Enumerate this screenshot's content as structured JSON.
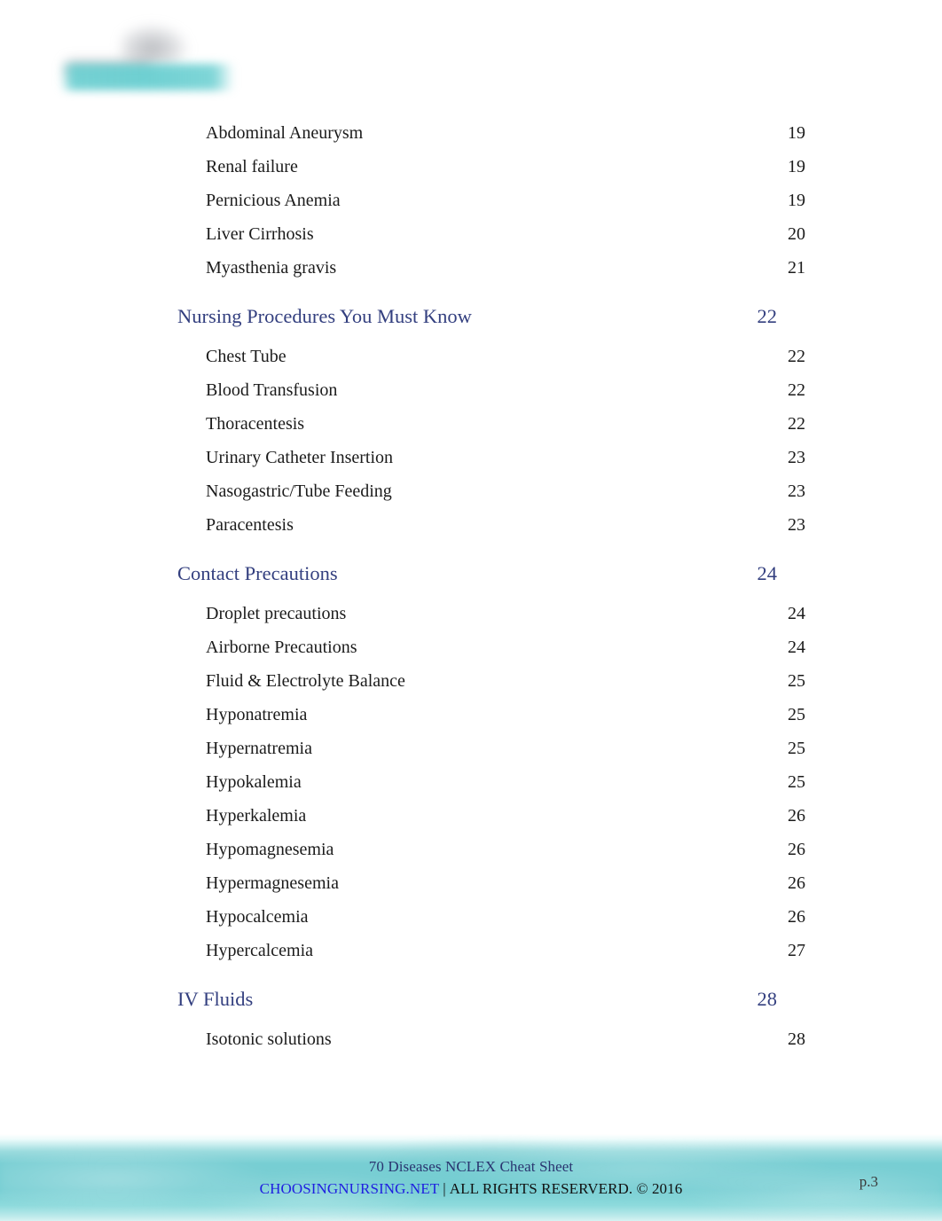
{
  "document": {
    "logo": {
      "alt": "choosingnursing-logo"
    },
    "toc": {
      "rows": [
        {
          "type": "entry",
          "label": "Abdominal Aneurysm",
          "page": "19"
        },
        {
          "type": "entry",
          "label": "Renal failure",
          "page": "19"
        },
        {
          "type": "entry",
          "label": "Pernicious Anemia",
          "page": "19"
        },
        {
          "type": "entry",
          "label": "Liver Cirrhosis",
          "page": "20"
        },
        {
          "type": "entry",
          "label": "Myasthenia gravis",
          "page": "21"
        },
        {
          "type": "section",
          "label": "Nursing Procedures You Must Know",
          "page": "22"
        },
        {
          "type": "entry",
          "label": "Chest Tube",
          "page": "22"
        },
        {
          "type": "entry",
          "label": "Blood Transfusion",
          "page": "22"
        },
        {
          "type": "entry",
          "label": "Thoracentesis",
          "page": "22"
        },
        {
          "type": "entry",
          "label": "Urinary Catheter Insertion",
          "page": "23"
        },
        {
          "type": "entry",
          "label": "Nasogastric/Tube Feeding",
          "page": "23"
        },
        {
          "type": "entry",
          "label": "Paracentesis",
          "page": "23"
        },
        {
          "type": "section",
          "label": "Contact Precautions",
          "page": "24"
        },
        {
          "type": "entry",
          "label": "Droplet precautions",
          "page": "24"
        },
        {
          "type": "entry",
          "label": "Airborne Precautions",
          "page": "24"
        },
        {
          "type": "entry",
          "label": "Fluid & Electrolyte Balance",
          "page": "25"
        },
        {
          "type": "entry",
          "label": "Hyponatremia",
          "page": "25"
        },
        {
          "type": "entry",
          "label": "Hypernatremia",
          "page": "25"
        },
        {
          "type": "entry",
          "label": "Hypokalemia",
          "page": "25"
        },
        {
          "type": "entry",
          "label": "Hyperkalemia",
          "page": "26"
        },
        {
          "type": "entry",
          "label": "Hypomagnesemia",
          "page": "26"
        },
        {
          "type": "entry",
          "label": "Hypermagnesemia",
          "page": "26"
        },
        {
          "type": "entry",
          "label": "Hypocalcemia",
          "page": "26"
        },
        {
          "type": "entry",
          "label": "Hypercalcemia",
          "page": "27"
        },
        {
          "type": "section",
          "label": "IV Fluids",
          "page": "28"
        },
        {
          "type": "entry",
          "label": "Isotonic solutions",
          "page": "28"
        }
      ]
    },
    "footer": {
      "title": "70 Diseases NCLEX Cheat Sheet",
      "url": "CHOOSINGNURSING.NET",
      "separator": "|",
      "rights": "ALL RIGHTS RESERVERD. © 2016",
      "page_number": "p.3"
    },
    "colors": {
      "section_blue": "#333f7f",
      "body_text": "#1b1b1b",
      "footer_teal": "#76ced3",
      "footer_title": "#2a3570",
      "footer_link": "#1f1fe0"
    }
  }
}
